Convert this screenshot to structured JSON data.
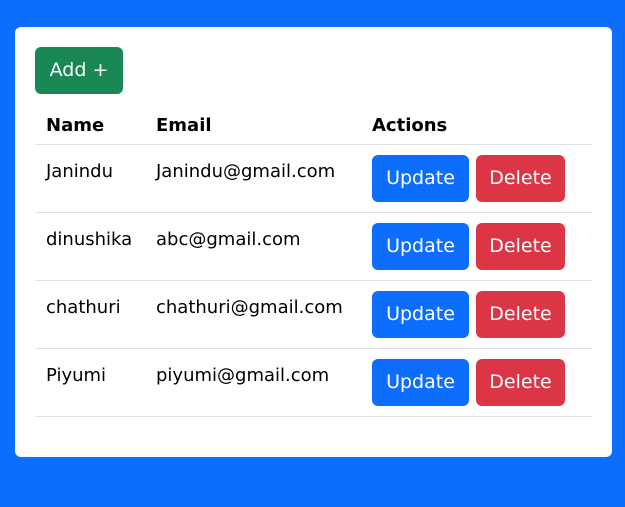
{
  "add_button_label": "Add +",
  "table": {
    "headers": {
      "name": "Name",
      "email": "Email",
      "actions": "Actions"
    },
    "rows": [
      {
        "name": "Janindu",
        "email": "Janindu@gmail.com",
        "update": "Update",
        "delete": "Delete"
      },
      {
        "name": "dinushika",
        "email": "abc@gmail.com",
        "update": "Update",
        "delete": "Delete"
      },
      {
        "name": "chathuri",
        "email": "chathuri@gmail.com",
        "update": "Update",
        "delete": "Delete"
      },
      {
        "name": "Piyumi",
        "email": "piyumi@gmail.com",
        "update": "Update",
        "delete": "Delete"
      }
    ]
  },
  "colors": {
    "page_background": "#0d6efd",
    "add_button": "#198754",
    "update_button": "#0d6efd",
    "delete_button": "#dc3545"
  }
}
